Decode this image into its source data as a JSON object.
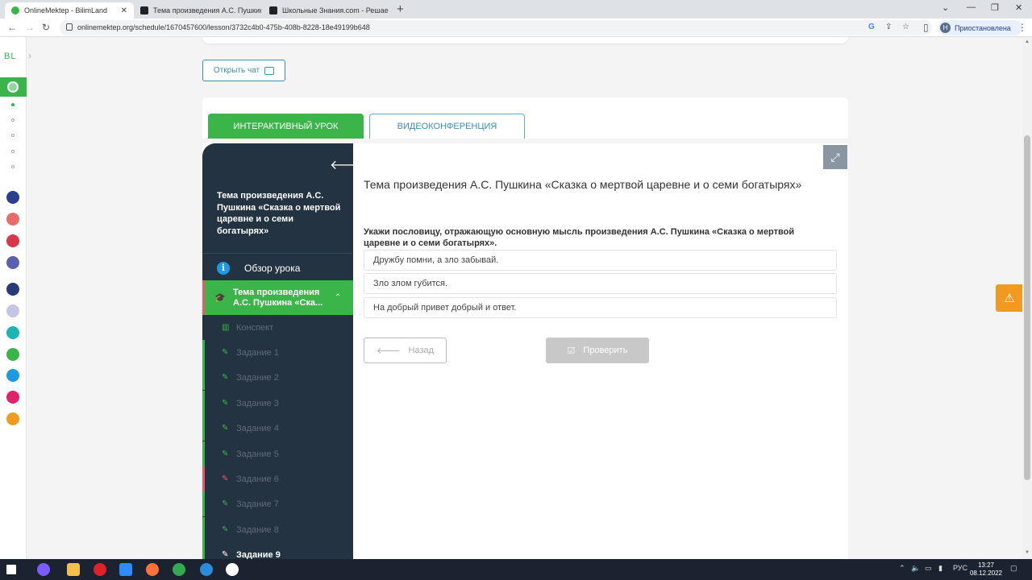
{
  "browser": {
    "tabs": [
      {
        "title": "OnlineMektep - BilimLand",
        "active": true
      },
      {
        "title": "Тема произведения А.С. Пушкина",
        "active": false
      },
      {
        "title": "Школьные Знания.com - Решае",
        "active": false
      }
    ],
    "new_tab": "+",
    "close_glyph": "✕",
    "url": "onlinemektep.org/schedule/1670457600/lesson/3732c4b0-475b-408b-8228-18e49199b648",
    "profile_initial": "Н",
    "profile_label": "Приостановлена"
  },
  "rail": {
    "logo": "BL"
  },
  "page": {
    "chat_button": "Открыть чат",
    "tab_interactive": "ИНТЕРАКТИВНЫЙ УРОК",
    "tab_video": "ВИДЕОКОНФЕРЕНЦИЯ"
  },
  "sidebar": {
    "lesson_title": "Тема произведения А.С. Пушкина «Сказка о мертвой царевне и о семи богатырях»",
    "overview": "Обзор урока",
    "topic": "Тема произведения А.С. Пушкина «Ска...",
    "items": [
      {
        "label": "Конспект"
      },
      {
        "label": "Задание 1"
      },
      {
        "label": "Задание 2"
      },
      {
        "label": "Задание 3"
      },
      {
        "label": "Задание 4"
      },
      {
        "label": "Задание 5"
      },
      {
        "label": "Задание 6"
      },
      {
        "label": "Задание 7"
      },
      {
        "label": "Задание 8"
      },
      {
        "label": "Задание 9"
      }
    ]
  },
  "question": {
    "title": "Тема произведения А.С. Пушкина «Сказка о мертвой царевне и о семи богатырях»",
    "prompt": "Укажи пословицу, отражающую основную мысль произведения А.С. Пушкина «Сказка о мертвой царевне и о семи богатырях».",
    "options": [
      "Дружбу помни, а зло забывай.",
      "Зло злом губится.",
      "На добрый привет добрый и ответ."
    ],
    "back_button": "Назад",
    "check_button": "Проверить"
  },
  "taskbar": {
    "lang": "РУС",
    "time": "13:27",
    "date": "08.12.2022"
  },
  "colors": {
    "accent_green": "#3bb54a",
    "sidebar_bg": "#243342",
    "link_blue": "#3c8fae",
    "warning_orange": "#f29a1f"
  }
}
